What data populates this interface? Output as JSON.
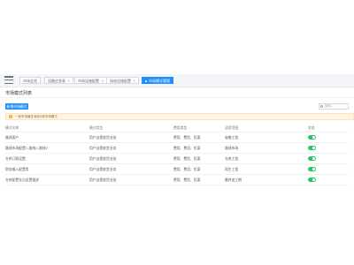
{
  "tabs": [
    {
      "label": "市场总览",
      "active": false,
      "closable": false
    },
    {
      "label": "设备信息表",
      "active": false,
      "closable": true
    },
    {
      "label": "市场设施配置",
      "active": false,
      "closable": true
    },
    {
      "label": "场站设施配置",
      "active": false,
      "closable": true
    },
    {
      "label": "市场模式管理",
      "active": true,
      "closable": false
    }
  ],
  "page": {
    "title": "市场模式列表",
    "add_button": "新增市场模式",
    "search_placeholder": "搜索…",
    "notice": "一家市场最多添加5种市场模式"
  },
  "table": {
    "headers": [
      "模式名称",
      "模式类型",
      "费用类型",
      "适用范围",
      "状态"
    ],
    "rows": [
      {
        "name": "路线客户",
        "type": "用户自提收货业务",
        "fee": "费用、费用、优惠",
        "scope": "省略工程",
        "enabled": true
      },
      {
        "name": "路线市场配置1-路线1-路线2",
        "type": "用户自提收货业务",
        "fee": "费用、费用、优惠",
        "scope": "路线市场",
        "enabled": true
      },
      {
        "name": "仓库订购设置",
        "type": "用户自提收货业务",
        "fee": "费用、费用、优惠",
        "scope": "仓库工程",
        "enabled": true
      },
      {
        "name": "财务输入配置类",
        "type": "用户自提收货业务",
        "fee": "费用、费用、优惠",
        "scope": "再生工程",
        "enabled": true
      },
      {
        "name": "仓库配置仓点设置描述",
        "type": "用户自提收货业务",
        "fee": "费用、费用、优惠",
        "scope": "最终加工期",
        "enabled": true
      }
    ]
  },
  "colors": {
    "accent": "#1f8fff",
    "toggle_on": "#2bc76a",
    "notice_bg": "#fff5e6"
  }
}
